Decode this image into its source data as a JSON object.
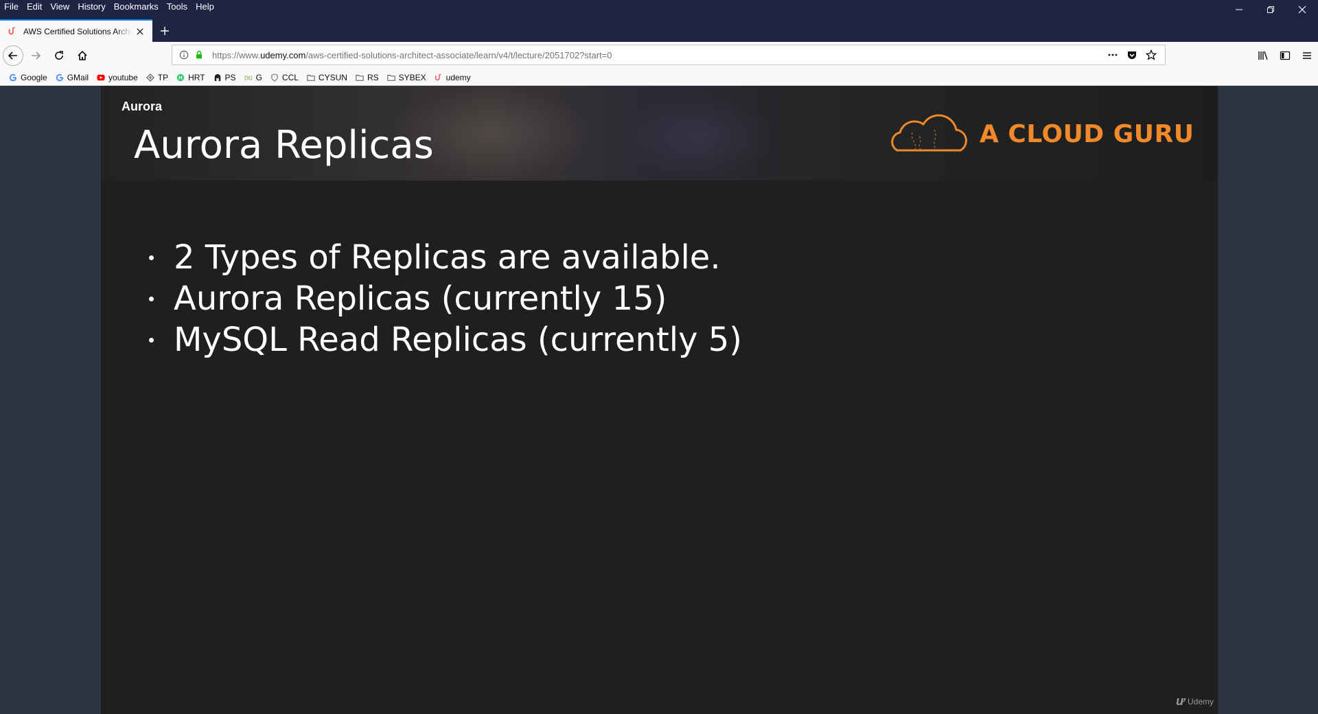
{
  "menu": [
    "File",
    "Edit",
    "View",
    "History",
    "Bookmarks",
    "Tools",
    "Help"
  ],
  "tab": {
    "title": "AWS Certified Solutions Architect",
    "favicon": "udemy-icon"
  },
  "url": {
    "prefix": "https://www.",
    "host": "udemy.com",
    "path": "/aws-certified-solutions-architect-associate/learn/v4/t/lecture/2051702?start=0"
  },
  "bookmarks": [
    {
      "label": "Google",
      "icon": "google-icon",
      "color": "#4285f4"
    },
    {
      "label": "GMail",
      "icon": "google-icon",
      "color": "#4285f4"
    },
    {
      "label": "youtube",
      "icon": "youtube-icon",
      "color": "#ff0000"
    },
    {
      "label": "TP",
      "icon": "tp-icon",
      "color": "#555555"
    },
    {
      "label": "HRT",
      "icon": "hackerrank-icon",
      "color": "#2ec866"
    },
    {
      "label": "PS",
      "icon": "ps-icon",
      "color": "#222222"
    },
    {
      "label": "G",
      "icon": "g-icon",
      "color": "#6a9f3f"
    },
    {
      "label": "CCL",
      "icon": "shield-icon",
      "color": "#777777"
    },
    {
      "label": "CYSUN",
      "icon": "folder-icon",
      "color": "#555555"
    },
    {
      "label": "RS",
      "icon": "folder-icon",
      "color": "#555555"
    },
    {
      "label": "SYBEX",
      "icon": "folder-icon",
      "color": "#555555"
    },
    {
      "label": "udemy",
      "icon": "udemy-icon",
      "color": "#ec5252"
    }
  ],
  "slide": {
    "section": "Aurora",
    "title": "Aurora Replicas",
    "logo_text": "A CLOUD GURU",
    "bullets": [
      "2 Types of Replicas are available.",
      "Aurora Replicas (currently 15)",
      "MySQL Read Replicas (currently 5)"
    ],
    "watermark": "Udemy"
  },
  "colors": {
    "accent": "#f0892a",
    "titlebar": "#1f2445",
    "tab_highlight": "#0a84ff"
  }
}
